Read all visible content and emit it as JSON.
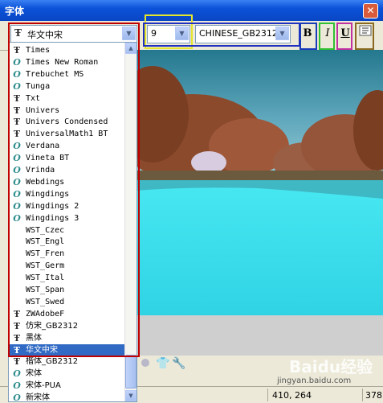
{
  "window": {
    "title": "字体",
    "close_glyph": "✕"
  },
  "toolbar": {
    "font_name": "华文中宋",
    "font_size": "9",
    "charset": "CHINESE_GB2312",
    "bold_label": "B",
    "italic_label": "I",
    "underline_label": "U",
    "highlight_colors": {
      "font": "#C00000",
      "size": "#E6E62A",
      "format": "#2030C0",
      "bold": "#1A3AB8",
      "italic": "#30C030",
      "underline": "#C030A0",
      "extra": "#8A6A20"
    }
  },
  "font_list": {
    "items": [
      {
        "label": "Times",
        "icon": "truetype-icon"
      },
      {
        "label": "Times New Roman",
        "icon": "opentype-icon"
      },
      {
        "label": "Trebuchet MS",
        "icon": "opentype-icon"
      },
      {
        "label": "Tunga",
        "icon": "opentype-icon"
      },
      {
        "label": "Txt",
        "icon": "truetype-icon"
      },
      {
        "label": "Univers",
        "icon": "truetype-icon"
      },
      {
        "label": "Univers Condensed",
        "icon": "truetype-icon"
      },
      {
        "label": "UniversalMath1 BT",
        "icon": "truetype-icon"
      },
      {
        "label": "Verdana",
        "icon": "opentype-icon"
      },
      {
        "label": "Vineta BT",
        "icon": "opentype-icon"
      },
      {
        "label": "Vrinda",
        "icon": "opentype-icon"
      },
      {
        "label": "Webdings",
        "icon": "opentype-icon"
      },
      {
        "label": "Wingdings",
        "icon": "opentype-icon"
      },
      {
        "label": "Wingdings 2",
        "icon": "opentype-icon"
      },
      {
        "label": "Wingdings 3",
        "icon": "opentype-icon"
      },
      {
        "label": "WST_Czec",
        "icon": ""
      },
      {
        "label": "WST_Engl",
        "icon": ""
      },
      {
        "label": "WST_Fren",
        "icon": ""
      },
      {
        "label": "WST_Germ",
        "icon": ""
      },
      {
        "label": "WST_Ital",
        "icon": ""
      },
      {
        "label": "WST_Span",
        "icon": ""
      },
      {
        "label": "WST_Swed",
        "icon": ""
      },
      {
        "label": "ZWAdobeF",
        "icon": "truetype-icon"
      },
      {
        "label": "仿宋_GB2312",
        "icon": "truetype-icon"
      },
      {
        "label": "黑体",
        "icon": "truetype-icon"
      },
      {
        "label": "华文中宋",
        "icon": "truetype-icon",
        "selected": true
      },
      {
        "label": "楷体_GB2312",
        "icon": "truetype-icon"
      },
      {
        "label": "宋体",
        "icon": "opentype-icon"
      },
      {
        "label": "宋体-PUA",
        "icon": "opentype-icon"
      },
      {
        "label": "新宋体",
        "icon": "opentype-icon"
      }
    ]
  },
  "status": {
    "coords": "410, 264",
    "right": "378:"
  },
  "watermark": {
    "brand": "Baidu经验",
    "url": "jingyan.baidu.com"
  }
}
